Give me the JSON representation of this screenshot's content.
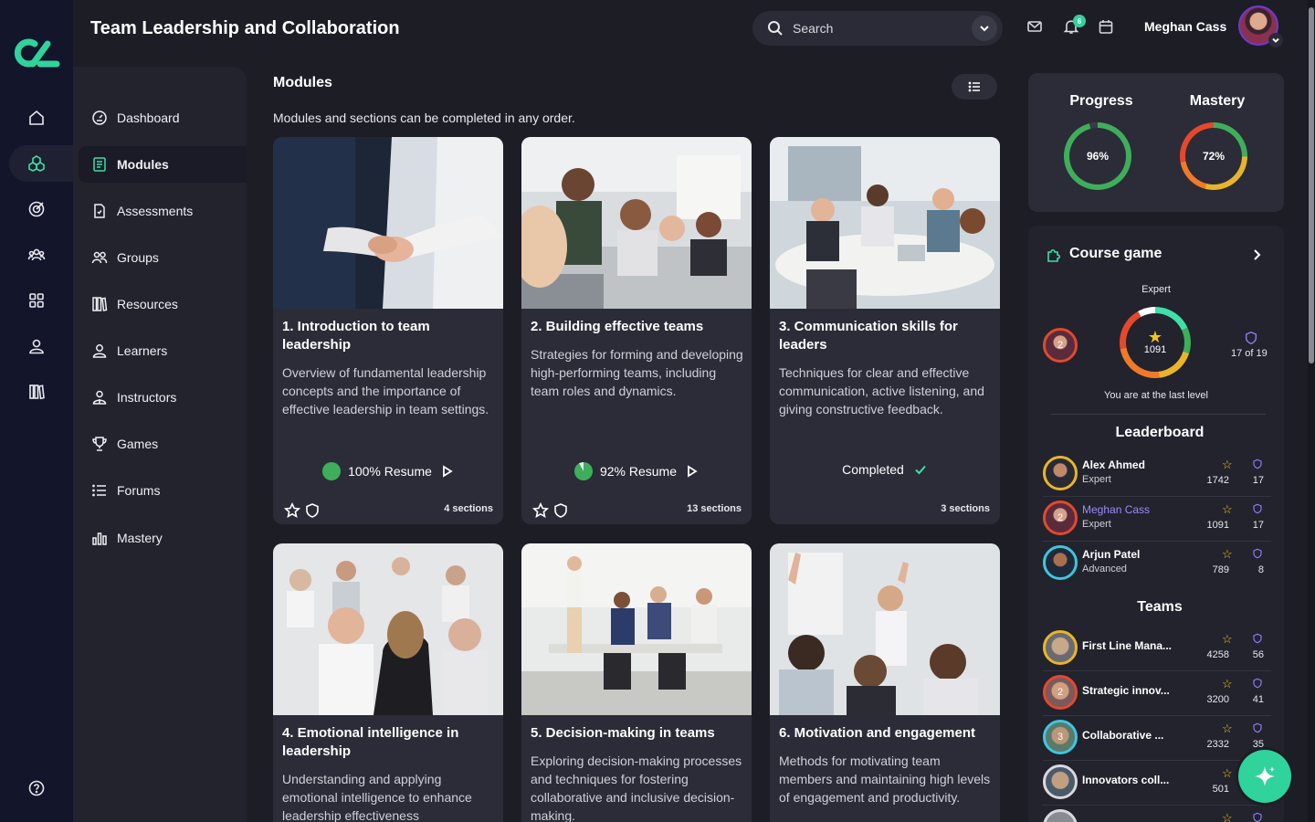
{
  "header": {
    "title": "Team Leadership and Collaboration",
    "search_placeholder": "Search",
    "notification_count": "6",
    "user_name": "Meghan Cass"
  },
  "nav": {
    "items": [
      {
        "label": "Dashboard",
        "icon": "dashboard-icon"
      },
      {
        "label": "Modules",
        "icon": "modules-icon",
        "active": true
      },
      {
        "label": "Assessments",
        "icon": "assessments-icon"
      },
      {
        "label": "Groups",
        "icon": "groups-icon"
      },
      {
        "label": "Resources",
        "icon": "resources-icon"
      },
      {
        "label": "Learners",
        "icon": "learner-icon"
      },
      {
        "label": "Instructors",
        "icon": "instructor-icon"
      },
      {
        "label": "Games",
        "icon": "trophy-icon"
      },
      {
        "label": "Forums",
        "icon": "forum-list-icon"
      },
      {
        "label": "Mastery",
        "icon": "chart-icon"
      }
    ]
  },
  "modules": {
    "title": "Modules",
    "subtitle": "Modules and sections can be completed in any order.",
    "cards": [
      {
        "title": "1. Introduction to team leadership",
        "description": "Overview of fundamental leadership concepts and the importance of effective leadership in team settings.",
        "status": "100% Resume",
        "progress": 100,
        "sections": "4 sections"
      },
      {
        "title": "2. Building effective teams",
        "description": "Strategies for forming and developing high-performing teams, including team roles and dynamics.",
        "status": "92% Resume",
        "progress": 92,
        "sections": "13 sections"
      },
      {
        "title": "3. Communication skills for leaders",
        "description": "Techniques for clear and effective communication, active listening, and giving constructive feedback.",
        "status": "Completed",
        "sections": "3 sections"
      },
      {
        "title": "4. Emotional intelligence in leadership",
        "description": "Understanding and applying emotional intelligence to enhance leadership effectiveness"
      },
      {
        "title": "5. Decision-making in teams",
        "description": "Exploring decision-making processes and techniques for fostering collaborative and inclusive decision-making."
      },
      {
        "title": "6. Motivation and engagement",
        "description": "Methods for motivating team members and maintaining high levels of engagement and productivity."
      }
    ]
  },
  "stats": {
    "progress_label": "Progress",
    "progress_value": "96%",
    "progress_pct": 96,
    "mastery_label": "Mastery",
    "mastery_value": "72%",
    "mastery_pct": 72
  },
  "course_game": {
    "title": "Course game",
    "level": "Expert",
    "points": "1091",
    "rank": "2",
    "badges": "17 of 19",
    "message": "You are at the last level"
  },
  "leaderboard": {
    "title": "Leaderboard",
    "rows": [
      {
        "name": "Alex Ahmed",
        "level": "Expert",
        "points": "1742",
        "badges": "17"
      },
      {
        "name": "Meghan Cass",
        "level": "Expert",
        "points": "1091",
        "badges": "17",
        "rank": "2"
      },
      {
        "name": "Arjun Patel",
        "level": "Advanced",
        "points": "789",
        "badges": "8"
      }
    ]
  },
  "teams": {
    "title": "Teams",
    "rows": [
      {
        "name": "First Line Mana...",
        "points": "4258",
        "badges": "56"
      },
      {
        "name": "Strategic innov...",
        "points": "3200",
        "badges": "41",
        "rank": "2"
      },
      {
        "name": "Collaborative ...",
        "points": "2332",
        "badges": "35",
        "rank": "3"
      },
      {
        "name": "Innovators coll...",
        "points": "501",
        "badges": ""
      }
    ]
  },
  "colors": {
    "accent": "#3ee0a6",
    "background": "#1d1d26",
    "card": "#2b2c38",
    "rail": "#13152b"
  }
}
